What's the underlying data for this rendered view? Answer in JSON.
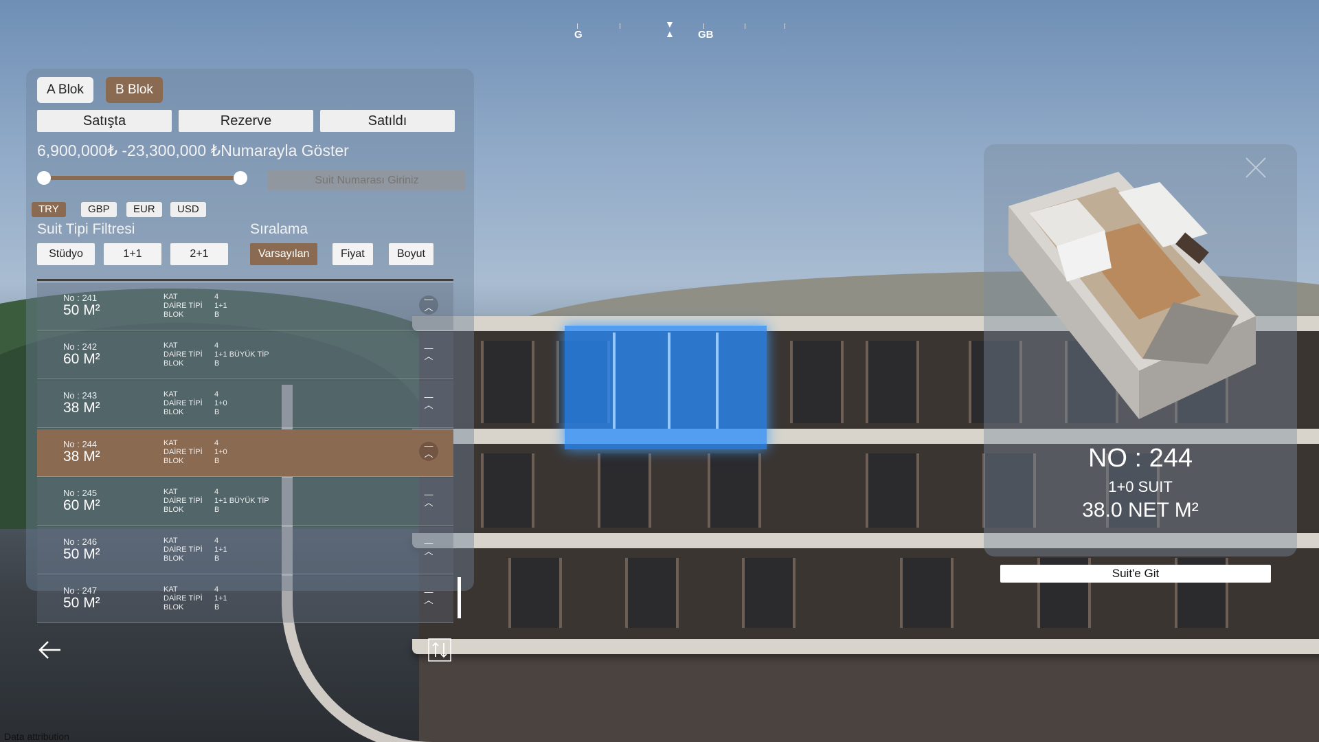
{
  "compass": {
    "left_label": "G",
    "right_label": "GB"
  },
  "blocks": [
    {
      "label": "A Blok",
      "active": false
    },
    {
      "label": "B Blok",
      "active": true
    }
  ],
  "status_filters": [
    "Satışta",
    "Rezerve",
    "Satıldı"
  ],
  "price": {
    "min": "6,900,000",
    "min_symbol": "₺",
    "separator": "-",
    "max": "23,300,000",
    "max_symbol": "₺",
    "show_by_number": "Numarayla Göster",
    "slider_min_fraction": 0.0,
    "slider_max_fraction": 1.0
  },
  "suite_input": {
    "placeholder": "Suit Numarası Giriniz"
  },
  "currencies": [
    {
      "label": "TRY",
      "active": true
    },
    {
      "label": "GBP",
      "active": false
    },
    {
      "label": "EUR",
      "active": false
    },
    {
      "label": "USD",
      "active": false
    }
  ],
  "suite_filter": {
    "title": "Suit Tipi Filtresi",
    "options": [
      "Stüdyo",
      "1+1",
      "2+1"
    ]
  },
  "sorting": {
    "title": "Sıralama",
    "options": [
      {
        "label": "Varsayılan",
        "active": true
      },
      {
        "label": "Fiyat",
        "active": false
      },
      {
        "label": "Boyut",
        "active": false
      }
    ]
  },
  "list_labels": {
    "kat": "KAT",
    "daire_tipi": "DAİRE TİPİ",
    "blok": "BLOK"
  },
  "units": [
    {
      "no": "No : 241",
      "size": "50 M²",
      "kat": "4",
      "tip": "1+1",
      "blok": "B",
      "selected": false
    },
    {
      "no": "No : 242",
      "size": "60 M²",
      "kat": "4",
      "tip": "1+1 BÜYÜK TİP",
      "blok": "B",
      "selected": false
    },
    {
      "no": "No : 243",
      "size": "38 M²",
      "kat": "4",
      "tip": "1+0",
      "blok": "B",
      "selected": false
    },
    {
      "no": "No : 244",
      "size": "38 M²",
      "kat": "4",
      "tip": "1+0",
      "blok": "B",
      "selected": true
    },
    {
      "no": "No : 245",
      "size": "60 M²",
      "kat": "4",
      "tip": "1+1 BÜYÜK TİP",
      "blok": "B",
      "selected": false
    },
    {
      "no": "No : 246",
      "size": "50 M²",
      "kat": "4",
      "tip": "1+1",
      "blok": "B",
      "selected": false
    },
    {
      "no": "No : 247",
      "size": "50 M²",
      "kat": "4",
      "tip": "1+1",
      "blok": "B",
      "selected": false
    }
  ],
  "detail": {
    "unit_no": "NO : 244",
    "unit_type": "1+0 SUIT",
    "unit_area": "38.0 NET M²",
    "goto_label": "Suit'e Git"
  },
  "attribution": "Data attribution",
  "colors": {
    "accent": "#8b6a52",
    "highlight": "#2f8cff"
  }
}
